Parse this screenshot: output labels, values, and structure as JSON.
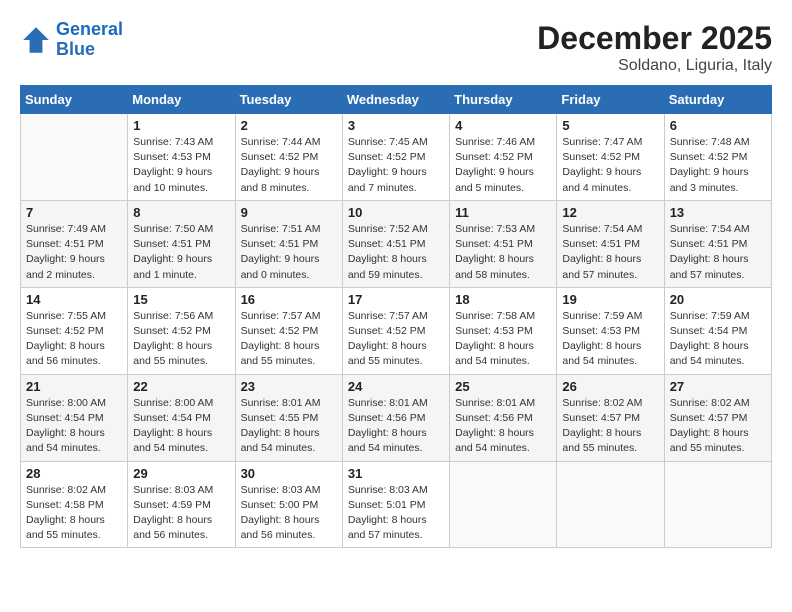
{
  "logo": {
    "line1": "General",
    "line2": "Blue"
  },
  "title": "December 2025",
  "location": "Soldano, Liguria, Italy",
  "headers": [
    "Sunday",
    "Monday",
    "Tuesday",
    "Wednesday",
    "Thursday",
    "Friday",
    "Saturday"
  ],
  "weeks": [
    [
      {
        "num": "",
        "info": ""
      },
      {
        "num": "1",
        "info": "Sunrise: 7:43 AM\nSunset: 4:53 PM\nDaylight: 9 hours\nand 10 minutes."
      },
      {
        "num": "2",
        "info": "Sunrise: 7:44 AM\nSunset: 4:52 PM\nDaylight: 9 hours\nand 8 minutes."
      },
      {
        "num": "3",
        "info": "Sunrise: 7:45 AM\nSunset: 4:52 PM\nDaylight: 9 hours\nand 7 minutes."
      },
      {
        "num": "4",
        "info": "Sunrise: 7:46 AM\nSunset: 4:52 PM\nDaylight: 9 hours\nand 5 minutes."
      },
      {
        "num": "5",
        "info": "Sunrise: 7:47 AM\nSunset: 4:52 PM\nDaylight: 9 hours\nand 4 minutes."
      },
      {
        "num": "6",
        "info": "Sunrise: 7:48 AM\nSunset: 4:52 PM\nDaylight: 9 hours\nand 3 minutes."
      }
    ],
    [
      {
        "num": "7",
        "info": "Sunrise: 7:49 AM\nSunset: 4:51 PM\nDaylight: 9 hours\nand 2 minutes."
      },
      {
        "num": "8",
        "info": "Sunrise: 7:50 AM\nSunset: 4:51 PM\nDaylight: 9 hours\nand 1 minute."
      },
      {
        "num": "9",
        "info": "Sunrise: 7:51 AM\nSunset: 4:51 PM\nDaylight: 9 hours\nand 0 minutes."
      },
      {
        "num": "10",
        "info": "Sunrise: 7:52 AM\nSunset: 4:51 PM\nDaylight: 8 hours\nand 59 minutes."
      },
      {
        "num": "11",
        "info": "Sunrise: 7:53 AM\nSunset: 4:51 PM\nDaylight: 8 hours\nand 58 minutes."
      },
      {
        "num": "12",
        "info": "Sunrise: 7:54 AM\nSunset: 4:51 PM\nDaylight: 8 hours\nand 57 minutes."
      },
      {
        "num": "13",
        "info": "Sunrise: 7:54 AM\nSunset: 4:51 PM\nDaylight: 8 hours\nand 57 minutes."
      }
    ],
    [
      {
        "num": "14",
        "info": "Sunrise: 7:55 AM\nSunset: 4:52 PM\nDaylight: 8 hours\nand 56 minutes."
      },
      {
        "num": "15",
        "info": "Sunrise: 7:56 AM\nSunset: 4:52 PM\nDaylight: 8 hours\nand 55 minutes."
      },
      {
        "num": "16",
        "info": "Sunrise: 7:57 AM\nSunset: 4:52 PM\nDaylight: 8 hours\nand 55 minutes."
      },
      {
        "num": "17",
        "info": "Sunrise: 7:57 AM\nSunset: 4:52 PM\nDaylight: 8 hours\nand 55 minutes."
      },
      {
        "num": "18",
        "info": "Sunrise: 7:58 AM\nSunset: 4:53 PM\nDaylight: 8 hours\nand 54 minutes."
      },
      {
        "num": "19",
        "info": "Sunrise: 7:59 AM\nSunset: 4:53 PM\nDaylight: 8 hours\nand 54 minutes."
      },
      {
        "num": "20",
        "info": "Sunrise: 7:59 AM\nSunset: 4:54 PM\nDaylight: 8 hours\nand 54 minutes."
      }
    ],
    [
      {
        "num": "21",
        "info": "Sunrise: 8:00 AM\nSunset: 4:54 PM\nDaylight: 8 hours\nand 54 minutes."
      },
      {
        "num": "22",
        "info": "Sunrise: 8:00 AM\nSunset: 4:54 PM\nDaylight: 8 hours\nand 54 minutes."
      },
      {
        "num": "23",
        "info": "Sunrise: 8:01 AM\nSunset: 4:55 PM\nDaylight: 8 hours\nand 54 minutes."
      },
      {
        "num": "24",
        "info": "Sunrise: 8:01 AM\nSunset: 4:56 PM\nDaylight: 8 hours\nand 54 minutes."
      },
      {
        "num": "25",
        "info": "Sunrise: 8:01 AM\nSunset: 4:56 PM\nDaylight: 8 hours\nand 54 minutes."
      },
      {
        "num": "26",
        "info": "Sunrise: 8:02 AM\nSunset: 4:57 PM\nDaylight: 8 hours\nand 55 minutes."
      },
      {
        "num": "27",
        "info": "Sunrise: 8:02 AM\nSunset: 4:57 PM\nDaylight: 8 hours\nand 55 minutes."
      }
    ],
    [
      {
        "num": "28",
        "info": "Sunrise: 8:02 AM\nSunset: 4:58 PM\nDaylight: 8 hours\nand 55 minutes."
      },
      {
        "num": "29",
        "info": "Sunrise: 8:03 AM\nSunset: 4:59 PM\nDaylight: 8 hours\nand 56 minutes."
      },
      {
        "num": "30",
        "info": "Sunrise: 8:03 AM\nSunset: 5:00 PM\nDaylight: 8 hours\nand 56 minutes."
      },
      {
        "num": "31",
        "info": "Sunrise: 8:03 AM\nSunset: 5:01 PM\nDaylight: 8 hours\nand 57 minutes."
      },
      {
        "num": "",
        "info": ""
      },
      {
        "num": "",
        "info": ""
      },
      {
        "num": "",
        "info": ""
      }
    ]
  ]
}
